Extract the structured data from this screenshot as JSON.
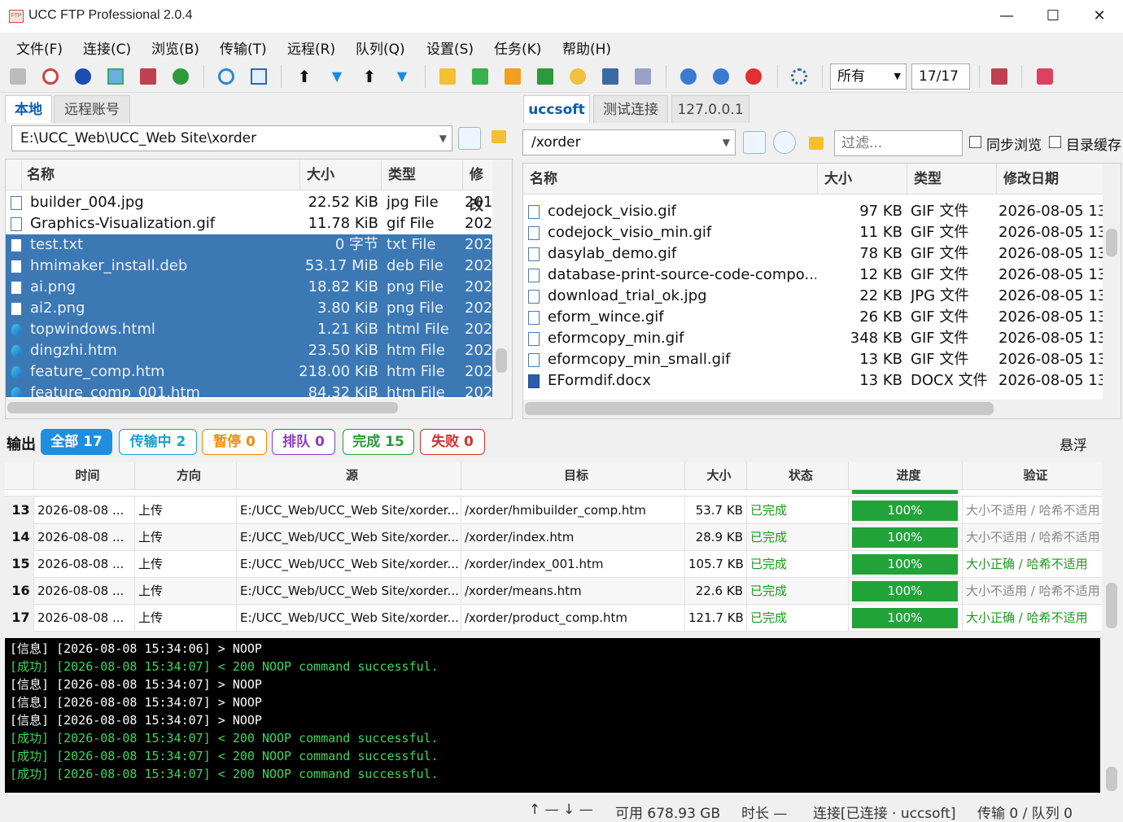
{
  "window": {
    "title": "UCC FTP Professional 2.0.4",
    "icon_label": "FTP",
    "minimize": "—",
    "maximize": "☐",
    "close": "✕"
  },
  "menu": [
    "文件(F)",
    "连接(C)",
    "浏览(B)",
    "传输(T)",
    "远程(R)",
    "队列(Q)",
    "设置(S)",
    "任务(K)",
    "帮助(H)"
  ],
  "toolbar": {
    "filter_value": "所有",
    "count": "17/17"
  },
  "local": {
    "tabs": [
      "本地",
      "远程账号"
    ],
    "path": "E:\\UCC_Web\\UCC_Web Site\\xorder",
    "columns": [
      "名称",
      "大小",
      "类型",
      "修改"
    ],
    "files": [
      {
        "name": "builder_004.jpg",
        "size": "22.52 KiB",
        "type": "jpg File",
        "date": "201",
        "sel": false,
        "icon": "image-file-icon"
      },
      {
        "name": "Graphics-Visualization.gif",
        "size": "11.78 KiB",
        "type": "gif File",
        "date": "202",
        "sel": false,
        "icon": "image-file-icon"
      },
      {
        "name": "test.txt",
        "size": "0 字节",
        "type": "txt File",
        "date": "202",
        "sel": true,
        "icon": "text-file-icon"
      },
      {
        "name": "hmimaker_install.deb",
        "size": "53.17 MiB",
        "type": "deb File",
        "date": "202",
        "sel": true,
        "icon": "file-icon"
      },
      {
        "name": "ai.png",
        "size": "18.82 KiB",
        "type": "png File",
        "date": "202",
        "sel": true,
        "icon": "image-file-icon"
      },
      {
        "name": "ai2.png",
        "size": "3.80 KiB",
        "type": "png File",
        "date": "202",
        "sel": true,
        "icon": "image-file-icon"
      },
      {
        "name": "topwindows.html",
        "size": "1.21 KiB",
        "type": "html File",
        "date": "202",
        "sel": true,
        "icon": "edge-icon"
      },
      {
        "name": "dingzhi.htm",
        "size": "23.50 KiB",
        "type": "htm File",
        "date": "202",
        "sel": true,
        "icon": "edge-icon"
      },
      {
        "name": "feature_comp.htm",
        "size": "218.00 KiB",
        "type": "htm File",
        "date": "202",
        "sel": true,
        "icon": "edge-icon"
      },
      {
        "name": "feature_comp_001.htm",
        "size": "84.32 KiB",
        "type": "htm File",
        "date": "202",
        "sel": true,
        "icon": "edge-icon"
      }
    ]
  },
  "remote": {
    "tabs": [
      "uccsoft",
      "测试连接",
      "127.0.0.1"
    ],
    "path": "/xorder",
    "filter_placeholder": "过滤...",
    "sync_browse": "同步浏览",
    "dir_cache": "目录缓存",
    "columns": [
      "名称",
      "大小",
      "类型",
      "修改日期"
    ],
    "files": [
      {
        "name": "codejock_visio.gif",
        "size": "97 KB",
        "type": "GIF 文件",
        "date": "2026-08-05 13",
        "icon": "image-file-icon"
      },
      {
        "name": "codejock_visio_min.gif",
        "size": "11 KB",
        "type": "GIF 文件",
        "date": "2026-08-05 13",
        "icon": "image-file-icon"
      },
      {
        "name": "dasylab_demo.gif",
        "size": "78 KB",
        "type": "GIF 文件",
        "date": "2026-08-05 13",
        "icon": "image-file-icon"
      },
      {
        "name": "database-print-source-code-compo...",
        "size": "12 KB",
        "type": "GIF 文件",
        "date": "2026-08-05 13",
        "icon": "image-file-icon"
      },
      {
        "name": "download_trial_ok.jpg",
        "size": "22 KB",
        "type": "JPG 文件",
        "date": "2026-08-05 13",
        "icon": "image-file-icon"
      },
      {
        "name": "eform_wince.gif",
        "size": "26 KB",
        "type": "GIF 文件",
        "date": "2026-08-05 13",
        "icon": "image-file-icon"
      },
      {
        "name": "eformcopy_min.gif",
        "size": "348 KB",
        "type": "GIF 文件",
        "date": "2026-08-05 13",
        "icon": "image-file-icon"
      },
      {
        "name": "eformcopy_min_small.gif",
        "size": "13 KB",
        "type": "GIF 文件",
        "date": "2026-08-05 13",
        "icon": "image-file-icon"
      },
      {
        "name": "EFormdif.docx",
        "size": "13 KB",
        "type": "DOCX 文件",
        "date": "2026-08-05 13",
        "icon": "word-file-icon"
      }
    ]
  },
  "output": {
    "label": "输出",
    "float_label": "悬浮",
    "badges": [
      {
        "label": "全部 17",
        "color": "#1e8fe0",
        "filled": true
      },
      {
        "label": "传输中 2",
        "color": "#1ea0c8",
        "filled": false
      },
      {
        "label": "暂停 0",
        "color": "#f08c00",
        "filled": false
      },
      {
        "label": "排队 0",
        "color": "#8a3fc0",
        "filled": false
      },
      {
        "label": "完成 15",
        "color": "#2a9a3a",
        "filled": false
      },
      {
        "label": "失败 0",
        "color": "#d83030",
        "filled": false
      }
    ],
    "columns": [
      "时间",
      "方向",
      "源",
      "目标",
      "大小",
      "状态",
      "进度",
      "验证"
    ],
    "rows": [
      {
        "n": "13",
        "time": "2026-08-08 ...",
        "dir": "上传",
        "src": "E:/UCC_Web/UCC_Web Site/xorder...",
        "dst": "/xorder/hmibuilder_comp.htm",
        "size": "53.7 KB",
        "status": "已完成",
        "progress": "100%",
        "verify": "大小不适用 / 哈希不适用",
        "ok": false
      },
      {
        "n": "14",
        "time": "2026-08-08 ...",
        "dir": "上传",
        "src": "E:/UCC_Web/UCC_Web Site/xorder...",
        "dst": "/xorder/index.htm",
        "size": "28.9 KB",
        "status": "已完成",
        "progress": "100%",
        "verify": "大小不适用 / 哈希不适用",
        "ok": false
      },
      {
        "n": "15",
        "time": "2026-08-08 ...",
        "dir": "上传",
        "src": "E:/UCC_Web/UCC_Web Site/xorder...",
        "dst": "/xorder/index_001.htm",
        "size": "105.7 KB",
        "status": "已完成",
        "progress": "100%",
        "verify": "大小正确 / 哈希不适用",
        "ok": true
      },
      {
        "n": "16",
        "time": "2026-08-08 ...",
        "dir": "上传",
        "src": "E:/UCC_Web/UCC_Web Site/xorder...",
        "dst": "/xorder/means.htm",
        "size": "22.6 KB",
        "status": "已完成",
        "progress": "100%",
        "verify": "大小不适用 / 哈希不适用",
        "ok": false
      },
      {
        "n": "17",
        "time": "2026-08-08 ...",
        "dir": "上传",
        "src": "E:/UCC_Web/UCC_Web Site/xorder...",
        "dst": "/xorder/product_comp.htm",
        "size": "121.7 KB",
        "status": "已完成",
        "progress": "100%",
        "verify": "大小正确 / 哈希不适用",
        "ok": true
      }
    ]
  },
  "log": [
    {
      "t": "[信息] [2026-08-08 15:34:06] > NOOP",
      "ok": false
    },
    {
      "t": "[成功] [2026-08-08 15:34:07] < 200 NOOP command successful.",
      "ok": true
    },
    {
      "t": "[信息] [2026-08-08 15:34:07] > NOOP",
      "ok": false
    },
    {
      "t": "[信息] [2026-08-08 15:34:07] > NOOP",
      "ok": false
    },
    {
      "t": "[信息] [2026-08-08 15:34:07] > NOOP",
      "ok": false
    },
    {
      "t": "[成功] [2026-08-08 15:34:07] < 200 NOOP command successful.",
      "ok": true
    },
    {
      "t": "[成功] [2026-08-08 15:34:07] < 200 NOOP command successful.",
      "ok": true
    },
    {
      "t": "[成功] [2026-08-08 15:34:07] < 200 NOOP command successful.",
      "ok": true
    }
  ],
  "status": {
    "speed": "↑ — ↓ —",
    "free": "可用 678.93 GB",
    "duration": "时长 —",
    "connection": "连接[已连接 · uccsoft]",
    "transfer": "传输 0 / 队列 0"
  }
}
